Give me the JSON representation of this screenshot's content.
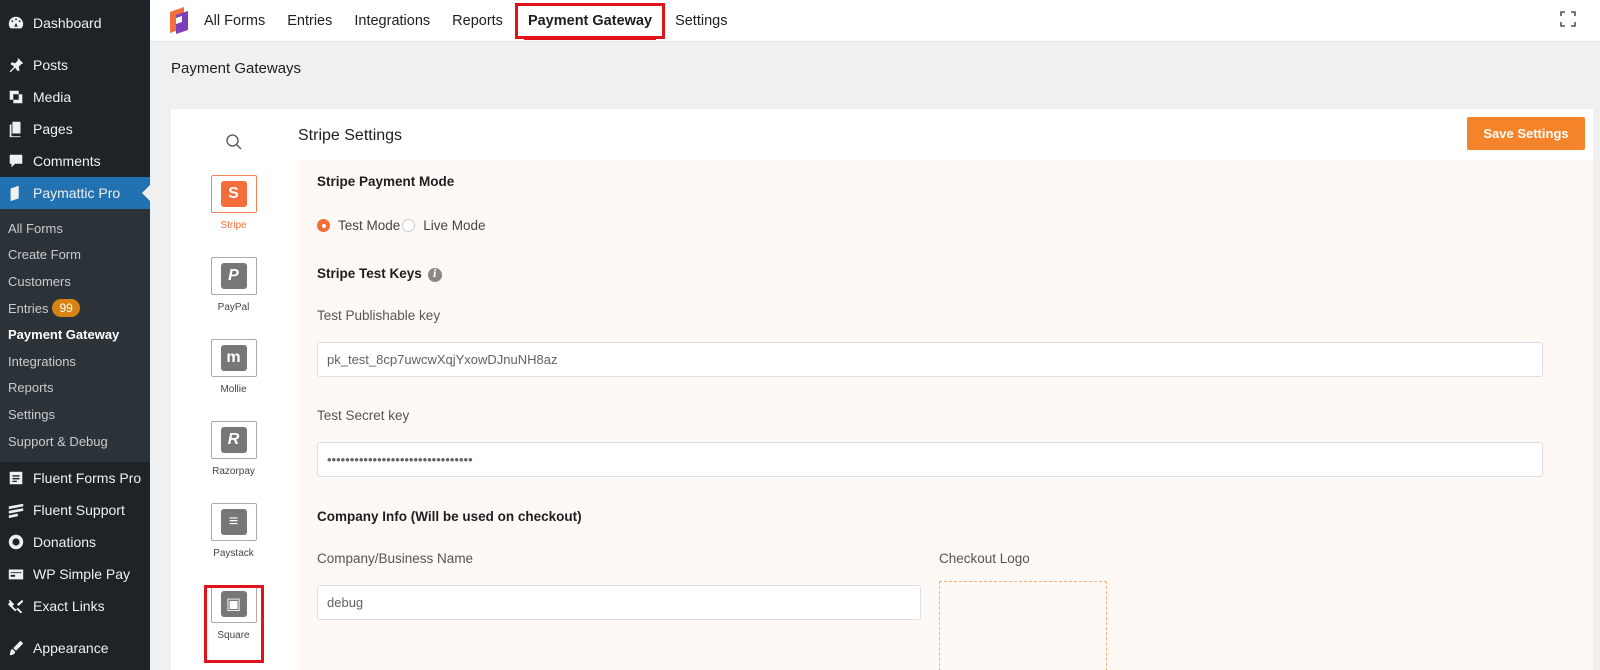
{
  "sidebar": {
    "top_items": [
      {
        "label": "Dashboard",
        "icon": "dashboard-icon"
      },
      {
        "label": "Posts",
        "icon": "pin-icon"
      },
      {
        "label": "Media",
        "icon": "media-icon"
      },
      {
        "label": "Pages",
        "icon": "pages-icon"
      },
      {
        "label": "Comments",
        "icon": "comment-icon"
      },
      {
        "label": "Paymattic Pro",
        "icon": "paymattic-icon"
      }
    ],
    "submenu": [
      {
        "label": "All Forms"
      },
      {
        "label": "Create Form"
      },
      {
        "label": "Customers"
      },
      {
        "label": "Entries",
        "badge": "99"
      },
      {
        "label": "Payment Gateway"
      },
      {
        "label": "Integrations"
      },
      {
        "label": "Reports"
      },
      {
        "label": "Settings"
      },
      {
        "label": "Support & Debug"
      }
    ],
    "bottom_items": [
      {
        "label": "Fluent Forms Pro",
        "icon": "fluent-forms-icon"
      },
      {
        "label": "Fluent Support",
        "icon": "fluent-support-icon"
      },
      {
        "label": "Donations",
        "icon": "donations-icon"
      },
      {
        "label": "WP Simple Pay",
        "icon": "simple-pay-icon"
      },
      {
        "label": "Exact Links",
        "icon": "links-icon"
      },
      {
        "label": "Appearance",
        "icon": "appearance-icon"
      }
    ]
  },
  "topnav": {
    "links": [
      "All Forms",
      "Entries",
      "Integrations",
      "Reports",
      "Payment Gateway",
      "Settings"
    ],
    "active": "Payment Gateway"
  },
  "page": {
    "heading": "Payment Gateways"
  },
  "gateways": [
    {
      "label": "Stripe",
      "glyph": "S"
    },
    {
      "label": "PayPal",
      "glyph": "P"
    },
    {
      "label": "Mollie",
      "glyph": "m"
    },
    {
      "label": "Razorpay",
      "glyph": "R"
    },
    {
      "label": "Paystack",
      "glyph": "≡"
    },
    {
      "label": "Square",
      "glyph": "▣"
    }
  ],
  "settings": {
    "title": "Stripe Settings",
    "save_label": "Save Settings",
    "payment_mode": {
      "heading": "Stripe Payment Mode",
      "options": [
        "Test Mode",
        "Live Mode"
      ],
      "selected": "Test Mode"
    },
    "test_keys": {
      "heading": "Stripe Test Keys",
      "publishable_label": "Test Publishable key",
      "publishable_value": "pk_test_8cp7uwcwXqjYxowDJnuNH8az",
      "secret_label": "Test Secret key",
      "secret_value": "••••••••••••••••••••••••••••••••"
    },
    "company": {
      "heading": "Company Info (Will be used on checkout)",
      "name_label": "Company/Business Name",
      "name_value": "debug",
      "logo_label": "Checkout Logo"
    }
  },
  "colors": {
    "accent": "#f5832a",
    "wp_active": "#2271b1",
    "highlight": "#e0131c"
  }
}
